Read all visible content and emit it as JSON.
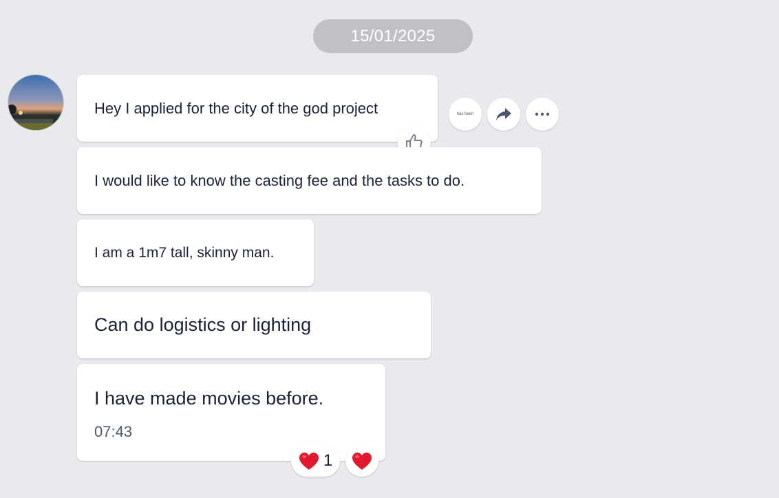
{
  "date_separator": "15/01/2025",
  "messages": [
    {
      "text": "Hey I applied for the city of the god project"
    },
    {
      "text": "I would like to know the casting fee and the tasks to do."
    },
    {
      "text": "I am a 1m7 tall, skinny man."
    },
    {
      "text": "Can do logistics or lighting"
    },
    {
      "text": "I have made movies before.",
      "time": "07:43"
    }
  ],
  "actions": {
    "react_label": "has been",
    "forward_icon": "forward-arrow-icon",
    "more_icon": "more-dots-icon"
  },
  "reactions": {
    "emoji": "heart",
    "count": "1"
  },
  "colors": {
    "background": "#e9eaee",
    "bubble": "#ffffff",
    "date_pill": "#bfc1c6",
    "text": "#1b2238",
    "heart": "#e0192e"
  }
}
